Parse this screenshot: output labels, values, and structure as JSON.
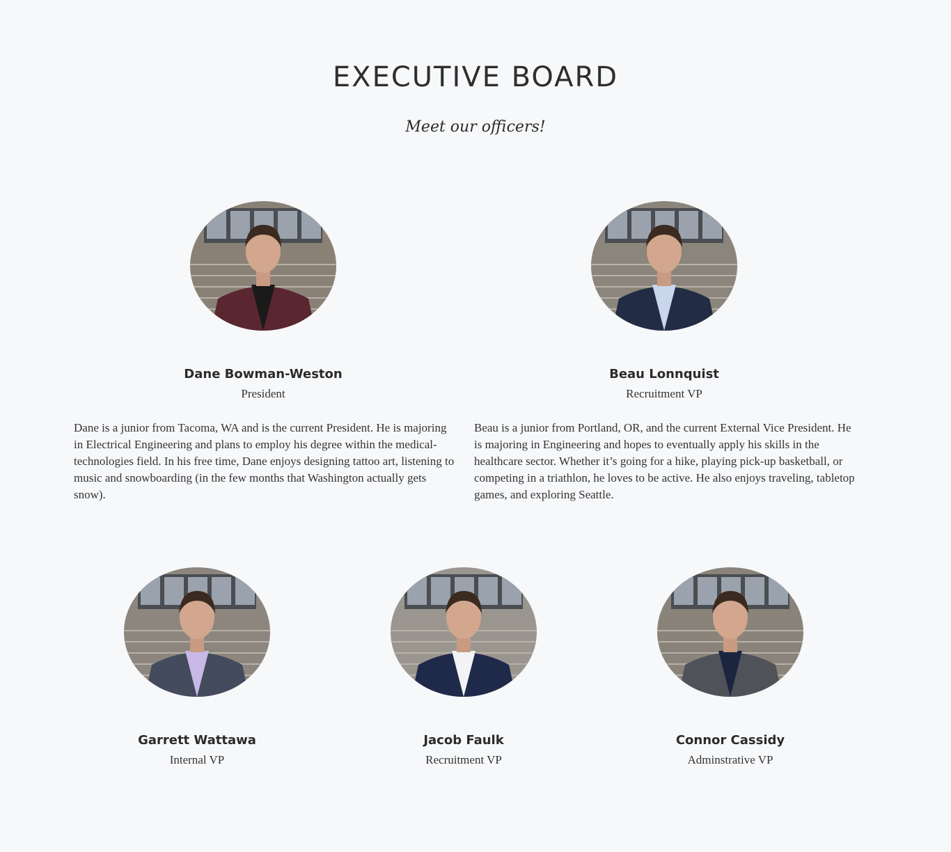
{
  "header": {
    "title": "EXECUTIVE BOARD",
    "subtitle": "Meet our officers!"
  },
  "members": [
    {
      "name": "Dane Bowman-Weston",
      "role": "President",
      "bio": "Dane is a junior from Tacoma, WA and is the current President. He is majoring in Electrical Engineering and plans to employ his degree within the medical-technologies field. In his free time, Dane enjoys designing tattoo art, listening to music and snowboarding (in the few months that Washington actually gets snow).",
      "suit_color": "#5a2630",
      "shirt_color": "#1a1a1a",
      "background_color": "#8a8176"
    },
    {
      "name": "Beau Lonnquist",
      "role": "Recruitment VP",
      "bio": "Beau is a junior from Portland, OR, and the current External Vice President. He is majoring in Engineering and hopes to eventually apply his skills in the healthcare sector. Whether it’s going for a hike, playing pick-up basketball, or competing in a triathlon, he loves to be active. He also enjoys traveling, tabletop games, and exploring Seattle.",
      "suit_color": "#232c45",
      "shirt_color": "#c9d6ec",
      "background_color": "#8c857c"
    },
    {
      "name": "Garrett Wattawa",
      "role": "Internal VP",
      "suit_color": "#434b5c",
      "shirt_color": "#c7b8e6",
      "background_color": "#8d867e"
    },
    {
      "name": "Jacob Faulk",
      "role": "Recruitment VP",
      "suit_color": "#1f2a4a",
      "shirt_color": "#f2f3f5",
      "background_color": "#9a958e"
    },
    {
      "name": "Connor Cassidy",
      "role": "Adminstrative VP",
      "suit_color": "#4f5359",
      "shirt_color": "#1c2540",
      "background_color": "#8a837a"
    }
  ]
}
